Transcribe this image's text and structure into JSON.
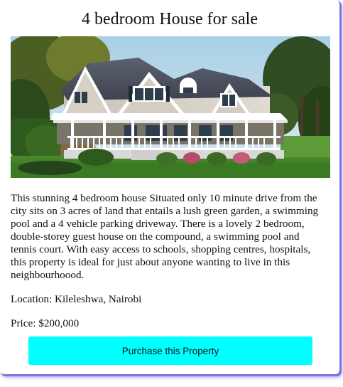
{
  "listing": {
    "title": "4 bedroom House for sale",
    "description": "This stunning 4 bedroom house Situated only 10 minute drive from the city sits on 3 acres of land that entails a lush green garden, a swimming pool and a 4 vehicle parking driveway. There is a lovely 2 bedroom, double-storey guest house on the compound, a swimming pool and tennis court. With easy access to schools, shopping centres, hospitals, this property is ideal for just about anyone wanting to live in this neighbourhoood.",
    "location": "Location: Kileleshwa, Nairobi",
    "price": "Price: $200,000",
    "purchase_label": "Purchase this Property"
  },
  "colors": {
    "button_bg": "#00ffff",
    "card_shadow": "#7a74e0"
  }
}
